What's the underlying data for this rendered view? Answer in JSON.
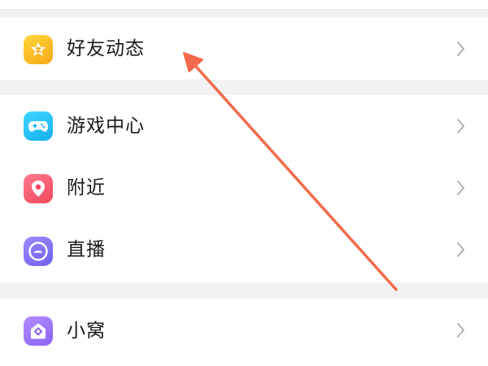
{
  "menu": {
    "items": [
      {
        "id": "friends",
        "label": "好友动态",
        "icon": "star-badge-icon"
      },
      {
        "id": "games",
        "label": "游戏中心",
        "icon": "gamepad-icon"
      },
      {
        "id": "nearby",
        "label": "附近",
        "icon": "location-pin-icon"
      },
      {
        "id": "live",
        "label": "直播",
        "icon": "live-stream-icon"
      },
      {
        "id": "nest",
        "label": "小窝",
        "icon": "home-diamond-icon"
      }
    ]
  },
  "colors": {
    "annotation_arrow": "#f26a4b",
    "icon_friends": "#f8b51f",
    "icon_games": "#22c1f7",
    "icon_nearby": "#f5566c",
    "icon_live": "#7f6ff6",
    "icon_nest": "#9470f5"
  }
}
